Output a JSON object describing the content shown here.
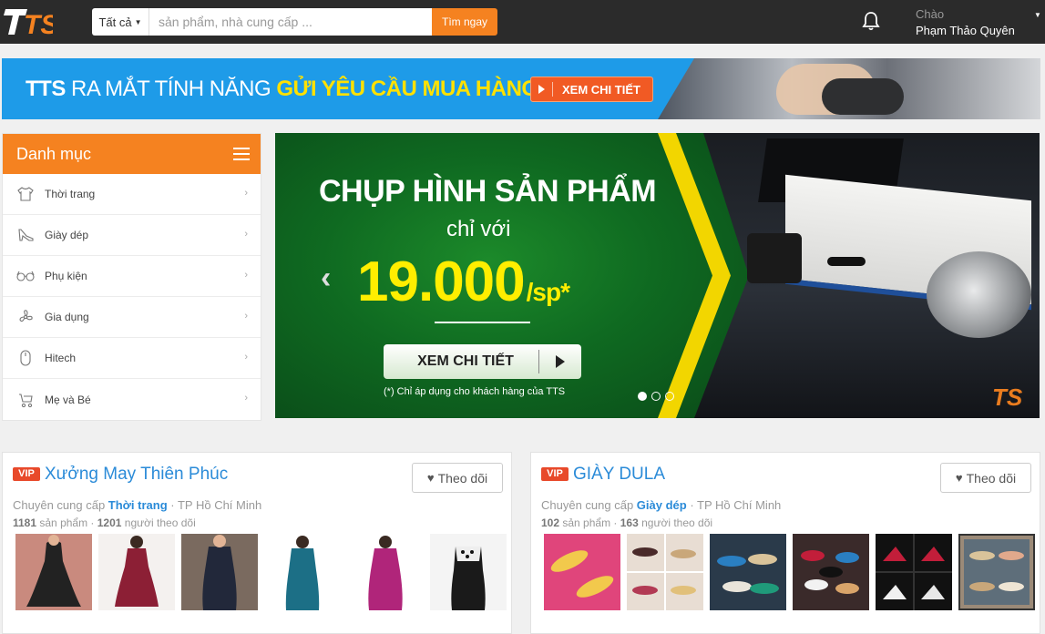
{
  "header": {
    "logo_text": "TS",
    "search": {
      "category": "Tất cả",
      "placeholder": "sản phẩm, nhà cung cấp ...",
      "button": "Tìm ngay"
    },
    "greeting": "Chào",
    "user_name": "Phạm Thảo Quyên"
  },
  "top_banner": {
    "text_part1": "TTS",
    "text_part2": " RA MẮT TÍNH NĂNG ",
    "text_highlight": "GỬI YÊU CẦU MUA HÀNG",
    "cta": "XEM CHI TIẾT"
  },
  "sidebar": {
    "title": "Danh mục",
    "items": [
      {
        "label": "Thời trang",
        "icon": "shirt-icon"
      },
      {
        "label": "Giày dép",
        "icon": "shoe-icon"
      },
      {
        "label": "Phụ kiện",
        "icon": "glasses-icon"
      },
      {
        "label": "Gia dụng",
        "icon": "fan-icon"
      },
      {
        "label": "Hitech",
        "icon": "mouse-icon"
      },
      {
        "label": "Mẹ và Bé",
        "icon": "stroller-icon"
      }
    ]
  },
  "hero": {
    "title": "CHỤP HÌNH SẢN PHẨM",
    "subtitle": "chỉ với",
    "price": "19.000",
    "unit": "/sp*",
    "button": "XEM CHI TIẾT",
    "note": "(*) Chỉ áp dụng cho khách hàng của TTS",
    "watermark": "TS",
    "active_slide": 1,
    "slide_count": 3
  },
  "shops": [
    {
      "badge": "VIP",
      "name": "Xưởng May Thiên Phúc",
      "follow": "Theo dõi",
      "supply_prefix": "Chuyên cung cấp ",
      "category": "Thời trang",
      "location": " · TP Hồ Chí Minh",
      "products": "1181",
      "products_label": " sản phẩm · ",
      "followers": "1201",
      "followers_label": " người theo dõi",
      "thumb_colors": [
        "#c98a7e",
        "#8c1f35",
        "#2a2f3a",
        "#1c6f86",
        "#b0257a",
        "#1a1a1a"
      ]
    },
    {
      "badge": "VIP",
      "name": "GIÀY DULA",
      "follow": "Theo dõi",
      "supply_prefix": "Chuyên cung cấp ",
      "category": "Giày dép",
      "location": " · TP Hồ Chí Minh",
      "products": "102",
      "products_label": " sản phẩm · ",
      "followers": "163",
      "followers_label": " người theo dõi",
      "thumb_colors": [
        "#e0457b",
        "#d9b8a0",
        "#2a5a8c",
        "#7a3b3b",
        "#c21e3a",
        "#9b8a78"
      ]
    }
  ],
  "colors": {
    "brand_orange": "#f58220",
    "link_blue": "#2b8bd8",
    "vip_red": "#e8492a"
  }
}
